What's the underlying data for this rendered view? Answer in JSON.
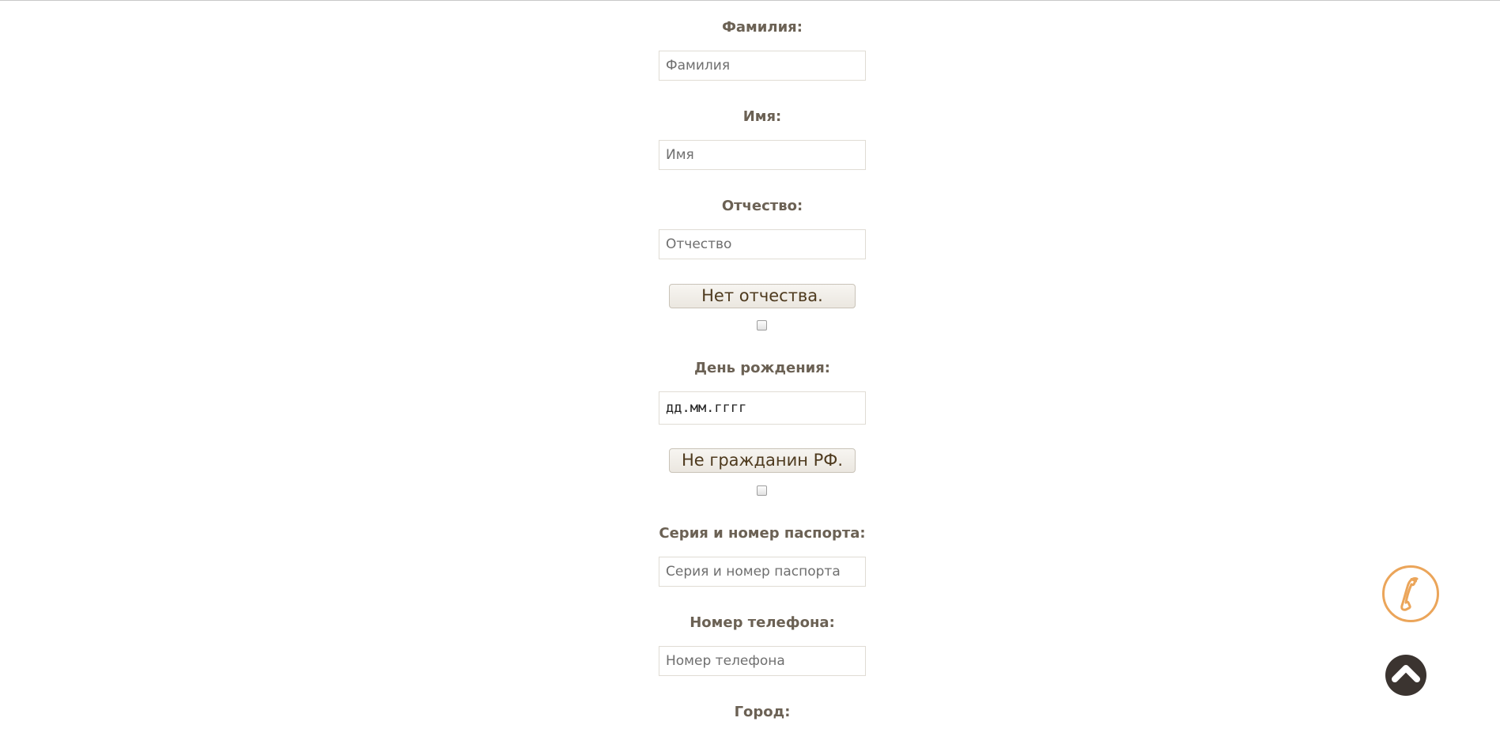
{
  "form": {
    "surname": {
      "label": "Фамилия:",
      "placeholder": "Фамилия"
    },
    "name": {
      "label": "Имя:",
      "placeholder": "Имя"
    },
    "patronymic": {
      "label": "Отчество:",
      "placeholder": "Отчество"
    },
    "no_patronymic_button": "Нет отчества.",
    "birthday": {
      "label": "День рождения:",
      "value": "дд.мм.гггг"
    },
    "not_citizen_button": "Не гражданин РФ.",
    "passport": {
      "label": "Серия и номер паспорта:",
      "placeholder": "Серия и номер паспорта"
    },
    "phone": {
      "label": "Номер телефона:",
      "placeholder": "Номер телефона"
    },
    "city": {
      "label": "Город:"
    }
  },
  "floating": {
    "call_icon": "phone-handset-icon",
    "scroll_top_icon": "chevron-up-icon",
    "accent_color": "#eba55a",
    "dark_color": "#3b3430"
  }
}
